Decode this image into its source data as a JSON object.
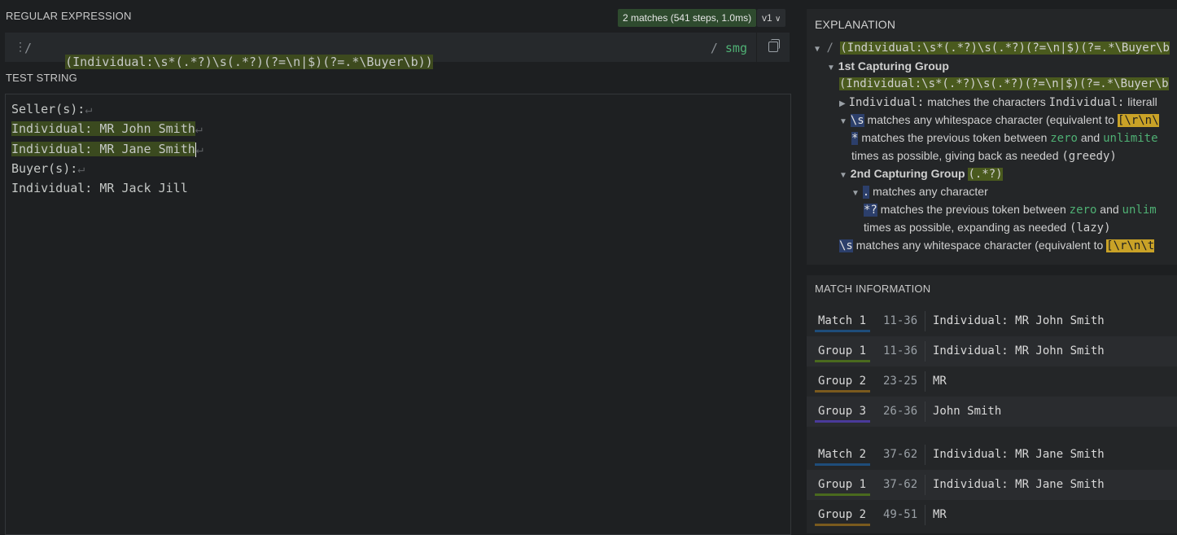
{
  "regex_section": {
    "label": "REGULAR EXPRESSION",
    "match_badge": "2 matches (541 steps, 1.0ms)",
    "version": "v1",
    "open_delim": "/",
    "pattern": "(Individual:\\s*(.*?)\\s(.*?)(?=\\n|$)(?=.*\\Buyer\\b))",
    "close_delim": "/",
    "flags": "smg"
  },
  "test_section": {
    "label": "TEST STRING",
    "lines": [
      "Seller(s):",
      "Individual: MR John Smith",
      "Individual: MR Jane Smith",
      "Buyer(s):",
      "Individual: MR Jack Jill"
    ]
  },
  "explanation": {
    "label": "EXPLANATION",
    "root_pattern": "(Individual:\\s*(.*?)\\s(.*?)(?=\\n|$)(?=.*\\Buyer\\b",
    "group1_title": "1st Capturing Group",
    "group1_pattern": "(Individual:\\s*(.*?)\\s(.*?)(?=\\n|$)(?=.*\\Buyer\\b",
    "item_individual": "matches the characters",
    "item_individual_tok": "Individual:",
    "item_individual_tail": "literall",
    "item_ws": "matches any whitespace character (equivalent to",
    "item_ws_tok": "[\\r\\n\\",
    "item_star": "matches the previous token between",
    "zero": "zero",
    "and": "and",
    "unlimited": "unlimite",
    "greedy_line": "times as possible, giving back as needed",
    "greedy": "(greedy)",
    "group2_title": "2nd Capturing Group",
    "group2_tok": "(.*?)",
    "dot_desc": "matches any character",
    "lazy_star_desc": "matches the previous token between",
    "unlim2": "unlim",
    "lazy_line": "times as possible, expanding as needed",
    "lazy": "(lazy)",
    "ws2_desc": "matches any whitespace character (equivalent to",
    "ws2_tok": "[\\r\\n\\t"
  },
  "match_info": {
    "label": "MATCH INFORMATION",
    "rows": [
      {
        "label": "Match 1",
        "range": "11-36",
        "value": "Individual: MR John Smith",
        "color": "#1e4d7a"
      },
      {
        "label": "Group 1",
        "range": "11-36",
        "value": "Individual: MR John Smith",
        "color": "#4a6a1e"
      },
      {
        "label": "Group 2",
        "range": "23-25",
        "value": "MR",
        "color": "#7a5a1e"
      },
      {
        "label": "Group 3",
        "range": "26-36",
        "value": "John Smith",
        "color": "#4a3a9a"
      },
      {
        "label": "Match 2",
        "range": "37-62",
        "value": "Individual: MR Jane Smith",
        "color": "#1e4d7a"
      },
      {
        "label": "Group 1",
        "range": "37-62",
        "value": "Individual: MR Jane Smith",
        "color": "#4a6a1e"
      },
      {
        "label": "Group 2",
        "range": "49-51",
        "value": "MR",
        "color": "#7a5a1e"
      }
    ]
  }
}
